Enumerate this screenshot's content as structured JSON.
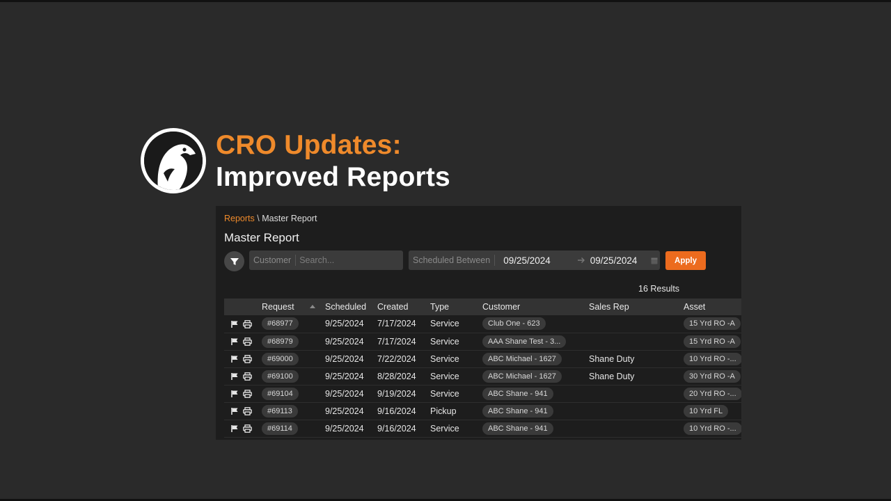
{
  "headline": {
    "line1": "CRO Updates:",
    "line2": "Improved Reports"
  },
  "breadcrumb": {
    "link": "Reports",
    "separator": "\\",
    "current": "Master Report"
  },
  "page_title": "Master Report",
  "filters": {
    "search_label": "Customer",
    "search_placeholder": "Search...",
    "date_label": "Scheduled Between",
    "date_from": "09/25/2024",
    "date_to": "09/25/2024",
    "apply_label": "Apply"
  },
  "results_text": "16 Results",
  "table": {
    "columns": [
      "Request",
      "Scheduled",
      "Created",
      "Type",
      "Customer",
      "Sales Rep",
      "Asset"
    ],
    "rows": [
      {
        "request": "#68977",
        "scheduled": "9/25/2024",
        "created": "7/17/2024",
        "type": "Service",
        "customer": "Club One - 623",
        "sales_rep": "",
        "asset": "15 Yrd RO -A"
      },
      {
        "request": "#68979",
        "scheduled": "9/25/2024",
        "created": "7/17/2024",
        "type": "Service",
        "customer": "AAA Shane Test - 3...",
        "sales_rep": "",
        "asset": "15 Yrd RO -A"
      },
      {
        "request": "#69000",
        "scheduled": "9/25/2024",
        "created": "7/22/2024",
        "type": "Service",
        "customer": "ABC Michael - 1627",
        "sales_rep": "Shane Duty",
        "asset": "10 Yrd RO -..."
      },
      {
        "request": "#69100",
        "scheduled": "9/25/2024",
        "created": "8/28/2024",
        "type": "Service",
        "customer": "ABC Michael - 1627",
        "sales_rep": "Shane Duty",
        "asset": "30 Yrd RO -A"
      },
      {
        "request": "#69104",
        "scheduled": "9/25/2024",
        "created": "9/19/2024",
        "type": "Service",
        "customer": "ABC Shane - 941",
        "sales_rep": "",
        "asset": "20 Yrd RO -..."
      },
      {
        "request": "#69113",
        "scheduled": "9/25/2024",
        "created": "9/16/2024",
        "type": "Pickup",
        "customer": "ABC Shane - 941",
        "sales_rep": "",
        "asset": "10 Yrd FL"
      },
      {
        "request": "#69114",
        "scheduled": "9/25/2024",
        "created": "9/16/2024",
        "type": "Service",
        "customer": "ABC Shane - 941",
        "sales_rep": "",
        "asset": "10 Yrd RO -..."
      }
    ]
  },
  "colors": {
    "accent": "#ef8a2b",
    "apply_button": "#ec6b1e",
    "service": "#d9c94d",
    "pickup": "#e86a78"
  },
  "icons": [
    "logo-bird-icon",
    "filter-icon",
    "arrow-right-icon",
    "calendar-icon",
    "flag-icon",
    "print-icon",
    "sort-asc-icon"
  ]
}
